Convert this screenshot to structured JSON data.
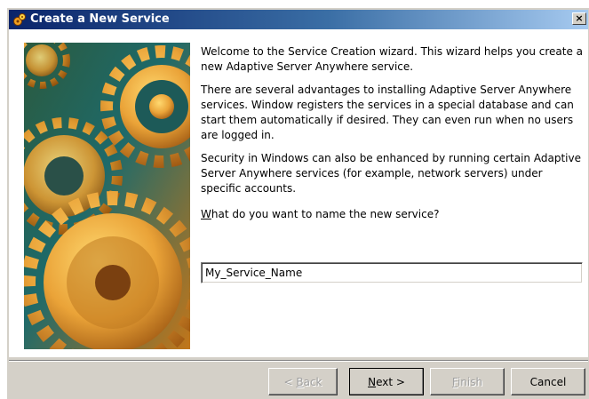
{
  "window": {
    "title": "Create a New Service",
    "close_glyph": "×"
  },
  "content": {
    "paragraph1": "Welcome to the Service Creation wizard. This wizard helps you create a new Adaptive Server Anywhere service.",
    "paragraph2": "There are several advantages to installing Adaptive Server Anywhere services. Window registers the services in a special database and can start them automatically if desired. They can even run when no users are logged in.",
    "paragraph3": "Security in Windows can also be enhanced by running certain Adaptive Server Anywhere services (for example, network servers) under specific accounts.",
    "question_accel": "W",
    "question_rest": "hat do you want to name the new service?"
  },
  "service_name_input": {
    "value": "My_Service_Name"
  },
  "buttons": {
    "back": {
      "pre": "< ",
      "accel": "B",
      "rest": "ack",
      "enabled": false
    },
    "next": {
      "accel": "N",
      "rest": "ext >",
      "enabled": true
    },
    "finish": {
      "accel": "F",
      "rest": "inish",
      "enabled": false
    },
    "cancel": {
      "label": "Cancel",
      "enabled": true
    }
  },
  "icons": {
    "title_icon": "gears-icon",
    "illustration": "gears-illustration"
  },
  "colors": {
    "titlebar_start": "#0a246a",
    "titlebar_end": "#a6caf0",
    "dialog_face": "#d4d0c8",
    "gear_orange": "#e8a23a",
    "art_background": "#1c4a3a"
  }
}
